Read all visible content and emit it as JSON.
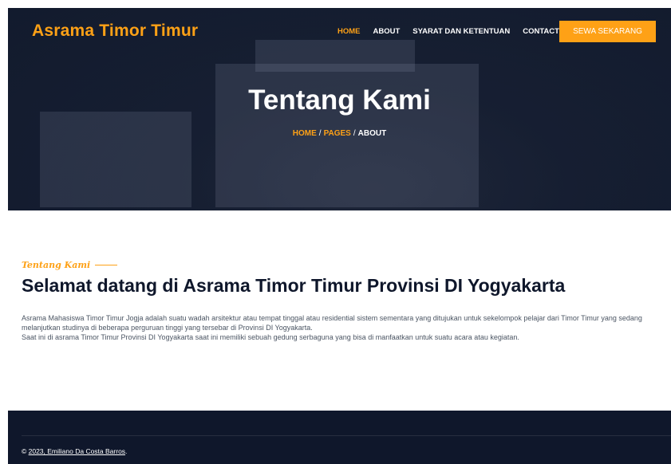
{
  "colors": {
    "accent": "#fea116",
    "navy": "#0f172b",
    "text": "#4b5563",
    "white": "#ffffff"
  },
  "header": {
    "brand": "Asrama Timor Timur",
    "nav": [
      {
        "label": "HOME",
        "active": true
      },
      {
        "label": "ABOUT",
        "active": false
      },
      {
        "label": "SYARAT DAN KETENTUAN",
        "active": false
      },
      {
        "label": "CONTACT",
        "active": false
      }
    ],
    "cta_label": "SEWA SEKARANG"
  },
  "hero": {
    "title": "Tentang Kami",
    "breadcrumb": {
      "home": "HOME",
      "pages": "PAGES",
      "current": "ABOUT",
      "separator": "/"
    }
  },
  "about": {
    "tag": "Tentang Kami",
    "title": "Selamat datang di Asrama Timor Timur Provinsi DI Yogyakarta",
    "paragraph1": "Asrama Mahasiswa Timor Timur Jogja adalah suatu wadah arsitektur atau tempat tinggal atau residential sistem sementara yang ditujukan untuk sekelompok pelajar dari Timor Timur yang sedang melanjutkan studinya di beberapa perguruan tinggi yang tersebar di Provinsi DI Yogyakarta.",
    "paragraph2": "Saat ini di asrama Timor Timur Provinsi DI Yogyakarta saat ini memiliki sebuah gedung serbaguna yang bisa di manfaatkan untuk suatu acara atau kegiatan."
  },
  "footer": {
    "copyright_prefix": "© ",
    "copyright_link": "2023, Emiliano Da Costa Barros",
    "copyright_suffix": "."
  }
}
